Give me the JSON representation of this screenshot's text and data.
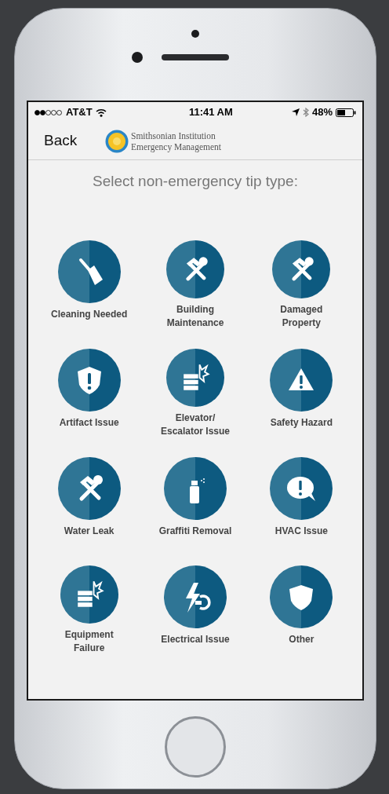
{
  "status_bar": {
    "carrier": "AT&T",
    "time": "11:41 AM",
    "battery": "48%"
  },
  "nav": {
    "back": "Back",
    "logo_line_1": "Smithsonian Institution",
    "logo_line_2": "Emergency Management"
  },
  "heading": "Select non-emergency tip type:",
  "tip_types": [
    {
      "kind": "broom",
      "label": [
        "Cleaning Needed"
      ]
    },
    {
      "kind": "tools",
      "label": [
        "Building",
        "Maintenance"
      ]
    },
    {
      "kind": "tools",
      "label": [
        "Damaged",
        "Property"
      ]
    },
    {
      "kind": "shield-alert",
      "label": [
        "Artifact Issue"
      ]
    },
    {
      "kind": "collision",
      "label": [
        "Elevator/",
        "Escalator Issue"
      ]
    },
    {
      "kind": "warning",
      "label": [
        "Safety Hazard"
      ]
    },
    {
      "kind": "tools",
      "label": [
        "Water Leak"
      ]
    },
    {
      "kind": "spray",
      "label": [
        "Graffiti Removal"
      ]
    },
    {
      "kind": "speech-alert",
      "label": [
        "HVAC Issue"
      ]
    },
    {
      "kind": "collision",
      "label": [
        "Equipment",
        "Failure"
      ]
    },
    {
      "kind": "bolt-plug",
      "label": [
        "Electrical Issue"
      ]
    },
    {
      "kind": "shield",
      "label": [
        "Other"
      ]
    }
  ]
}
